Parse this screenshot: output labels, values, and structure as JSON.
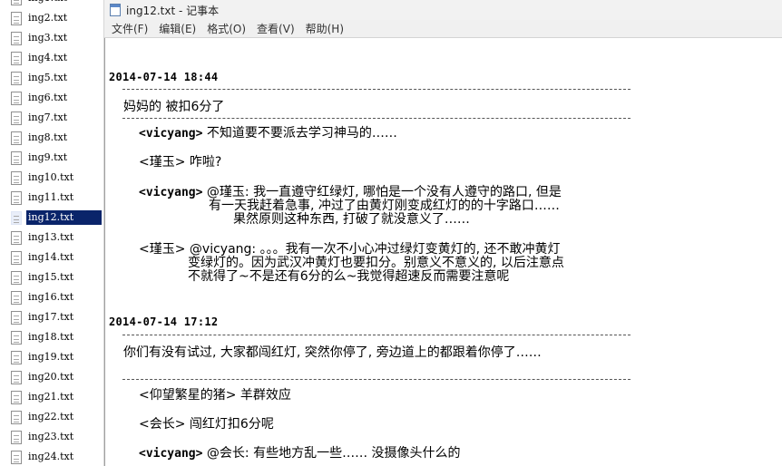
{
  "file_list": [
    {
      "name": "ing1.txt",
      "selected": false
    },
    {
      "name": "ing2.txt",
      "selected": false
    },
    {
      "name": "ing3.txt",
      "selected": false
    },
    {
      "name": "ing4.txt",
      "selected": false
    },
    {
      "name": "ing5.txt",
      "selected": false
    },
    {
      "name": "ing6.txt",
      "selected": false
    },
    {
      "name": "ing7.txt",
      "selected": false
    },
    {
      "name": "ing8.txt",
      "selected": false
    },
    {
      "name": "ing9.txt",
      "selected": false
    },
    {
      "name": "ing10.txt",
      "selected": false
    },
    {
      "name": "ing11.txt",
      "selected": false
    },
    {
      "name": "ing12.txt",
      "selected": true
    },
    {
      "name": "ing13.txt",
      "selected": false
    },
    {
      "name": "ing14.txt",
      "selected": false
    },
    {
      "name": "ing15.txt",
      "selected": false
    },
    {
      "name": "ing16.txt",
      "selected": false
    },
    {
      "name": "ing17.txt",
      "selected": false
    },
    {
      "name": "ing18.txt",
      "selected": false
    },
    {
      "name": "ing19.txt",
      "selected": false
    },
    {
      "name": "ing20.txt",
      "selected": false
    },
    {
      "name": "ing21.txt",
      "selected": false
    },
    {
      "name": "ing22.txt",
      "selected": false
    },
    {
      "name": "ing23.txt",
      "selected": false
    },
    {
      "name": "ing24.txt",
      "selected": false
    }
  ],
  "window": {
    "title": "ing12.txt - 记事本",
    "icon": "notepad-icon"
  },
  "menu": [
    "文件(F)",
    "编辑(E)",
    "格式(O)",
    "查看(V)",
    "帮助(H)"
  ],
  "entries": [
    {
      "date": "2014-07-14 18:44",
      "post": "妈妈的 被扣6分了",
      "replies": [
        {
          "author": "<vicyang>",
          "lines": [
            "不知道要不要派去学习神马的……"
          ]
        },
        {
          "author": "<瑾玉>",
          "lines": [
            "咋啦?"
          ]
        },
        {
          "author": "<vicyang>",
          "lines": [
            "@瑾玉: 我一直遵守红绿灯, 哪怕是一个没有人遵守的路口, 但是",
            "有一天我赶着急事, 冲过了由黄灯刚变成红灯的的十字路口……",
            "果然原则这种东西, 打破了就没意义了……"
          ]
        },
        {
          "author": "<瑾玉>",
          "lines": [
            "@vicyang: 。。。我有一次不小心冲过绿灯变黄灯的, 还不敢冲黄灯",
            "变绿灯的。因为武汉冲黄灯也要扣分。别意义不意义的, 以后注意点",
            "不就得了~不是还有6分的么~我觉得超速反而需要注意呢"
          ]
        }
      ]
    },
    {
      "date": "2014-07-14 17:12",
      "post": "你们有没有试过, 大家都闯红灯, 突然你停了, 旁边道上的都跟着你停了……",
      "replies": [
        {
          "author": "<仰望繁星的猪>",
          "lines": [
            "羊群效应"
          ]
        },
        {
          "author": "<会长>",
          "lines": [
            "闯红灯扣6分呢"
          ]
        },
        {
          "author": "<vicyang>",
          "lines": [
            "@会长: 有些地方乱一些…… 没摄像头什么的"
          ]
        }
      ]
    }
  ]
}
